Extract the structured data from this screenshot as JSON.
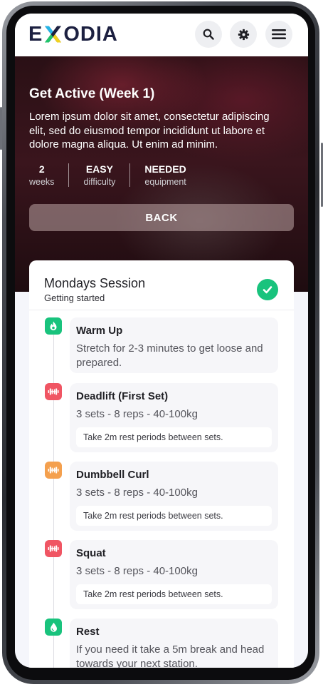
{
  "app": {
    "logo_text_left": "E",
    "logo_text_right": "ODIA"
  },
  "header": {
    "search_icon": "search-icon",
    "settings_icon": "gear-icon",
    "menu_icon": "hamburger-menu-icon"
  },
  "program": {
    "title": "Get Active (Week 1)",
    "description": "Lorem ipsum dolor sit amet, consectetur adipiscing elit, sed do eiusmod tempor incididunt ut labore et dolore magna aliqua. Ut enim ad minim.",
    "stats": [
      {
        "value": "2",
        "label": "weeks"
      },
      {
        "value": "EASY",
        "label": "difficulty"
      },
      {
        "value": "NEEDED",
        "label": "equipment"
      }
    ],
    "back_label": "BACK"
  },
  "session": {
    "title": "Mondays Session",
    "subtitle": "Getting started",
    "completed": true,
    "steps": [
      {
        "title": "Warm Up",
        "text": "Stretch for 2-3 minutes to get loose and prepared.",
        "icon": "flame-icon",
        "color": "#19c37d"
      },
      {
        "title": "Deadlift (First Set)",
        "text": "3 sets - 8 reps - 40-100kg",
        "note": "Take 2m rest periods between sets.",
        "icon": "dumbbell-icon",
        "color": "#f05563"
      },
      {
        "title": "Dumbbell Curl",
        "text": "3 sets - 8 reps - 40-100kg",
        "note": "Take 2m rest periods between sets.",
        "icon": "dumbbell-icon",
        "color": "#f4a04e"
      },
      {
        "title": "Squat",
        "text": "3 sets - 8 reps - 40-100kg",
        "note": "Take 2m rest periods between sets.",
        "icon": "dumbbell-icon",
        "color": "#f05563"
      },
      {
        "title": "Rest",
        "text": "If you need it take a 5m break and head towards your next station.",
        "icon": "water-drop-icon",
        "color": "#19c37d"
      }
    ]
  }
}
